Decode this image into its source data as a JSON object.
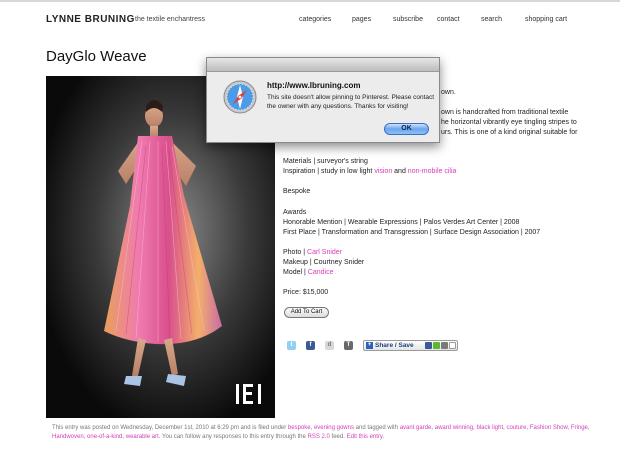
{
  "site": {
    "brand": "LYNNE BRUNING",
    "tagline": "the textile enchantress"
  },
  "nav": {
    "categories": "categories",
    "pages": "pages",
    "subscribe": "subscribe",
    "contact": "contact",
    "search": "search",
    "cart": "shopping cart"
  },
  "page_title": "DayGlo Weave",
  "description": {
    "line1_tail": "own.",
    "line2_tail": "own is handcrafted from traditional textile",
    "line3_tail": "he horizontal vibrantly eye tingling stripes to",
    "line4_tail": "urs.  This is one of a kind original suitable for"
  },
  "materials": "Materials | surveyor's string",
  "inspiration": {
    "prefix": "Inspiration | study in low light ",
    "link1": "vision",
    "mid": " and ",
    "link2": "non-mobile cilia"
  },
  "bespoke": "Bespoke",
  "awards": {
    "heading": "Awards",
    "line1": "Honorable Mention | Wearable Expressions | Palos Verdes Art Center | 2008",
    "line2": "First Place | Transformation and Transgression | Surface Design Association | 2007"
  },
  "credits": {
    "photo_prefix": "Photo | ",
    "photo_link": "Carl Snider",
    "makeup": "Makeup | Courtney Snider",
    "model_prefix": "Model | ",
    "model_link": "Candice"
  },
  "price": "Price: $15,000",
  "add_to_cart": "Add To Cart",
  "share_label": "Share / Save",
  "footer": {
    "t1": "This entry was posted on Wednesday, December 1st, 2010 at 6:29 pm and is filed under ",
    "l1": "bespoke",
    "t2": ", ",
    "l2": "evening gowns",
    "t3": " and tagged with ",
    "l3": "avant garde",
    "t4": ", ",
    "l4": "award winning",
    "t5": ", ",
    "l5": "black light",
    "t6": ", ",
    "l6": "couture",
    "t7": ", ",
    "l7": "Fashion Show",
    "t8": ", ",
    "l8": "Fringe",
    "t9": ", ",
    "l9": "Handwoven",
    "t10": ", ",
    "l10": "one-of-a-kind",
    "t11": ", ",
    "l11": "wearable art",
    "t12": ". You can follow any responses to this entry through the ",
    "l12": "RSS 2.0",
    "t13": " feed. ",
    "l13": "Edit this entry",
    "t14": "."
  },
  "dialog": {
    "url": "http://www.lbruning.com",
    "message": "This site doesn't allow pinning to Pinterest. Please contact the owner with any questions. Thanks for visiting!",
    "ok": "OK"
  },
  "icons": {
    "twitter": "twitter-icon",
    "facebook": "facebook-icon",
    "digg": "digg-icon",
    "tumblr": "tumblr-icon",
    "safari": "safari-compass-icon"
  },
  "colors": {
    "link": "#d43fb8",
    "ok_button": "#6aa5ee",
    "photo_bg": "#0a0a0a"
  }
}
